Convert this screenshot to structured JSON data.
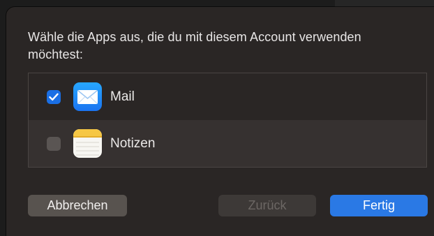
{
  "dialog": {
    "prompt": "Wähle die Apps aus, die du mit diesem Account verwenden möchtest:"
  },
  "apps": [
    {
      "label": "Mail",
      "checked": true,
      "icon": "mail-icon"
    },
    {
      "label": "Notizen",
      "checked": false,
      "icon": "notes-icon"
    }
  ],
  "buttons": {
    "cancel": "Abbrechen",
    "back": "Zurück",
    "done": "Fertig"
  },
  "colors": {
    "accent": "#2a79e5",
    "sheet_background": "#2a2625"
  }
}
